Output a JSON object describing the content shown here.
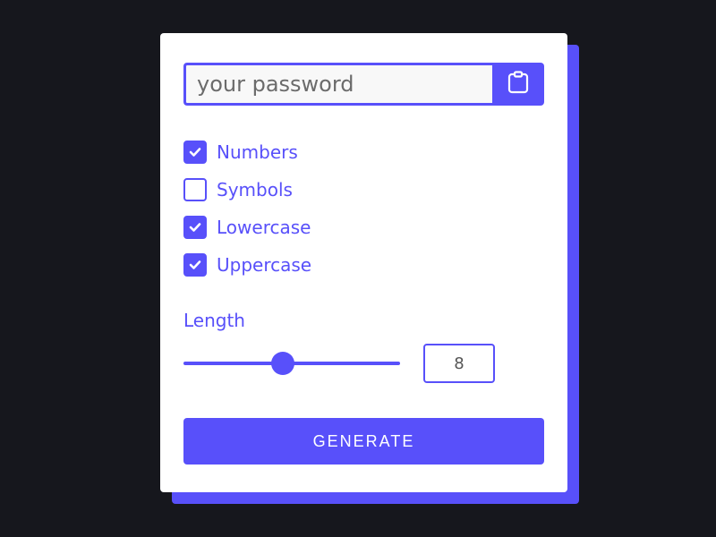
{
  "password": {
    "value": "",
    "placeholder": "your password",
    "copy_icon": "clipboard-icon"
  },
  "options": [
    {
      "label": "Numbers",
      "checked": true
    },
    {
      "label": "Symbols",
      "checked": false
    },
    {
      "label": "Lowercase",
      "checked": true
    },
    {
      "label": "Uppercase",
      "checked": true
    }
  ],
  "length": {
    "label": "Length",
    "value": "8"
  },
  "generate_button": {
    "label": "GENERATE"
  },
  "colors": {
    "accent": "#5850fa",
    "background": "#16171d",
    "card": "#ffffff"
  }
}
